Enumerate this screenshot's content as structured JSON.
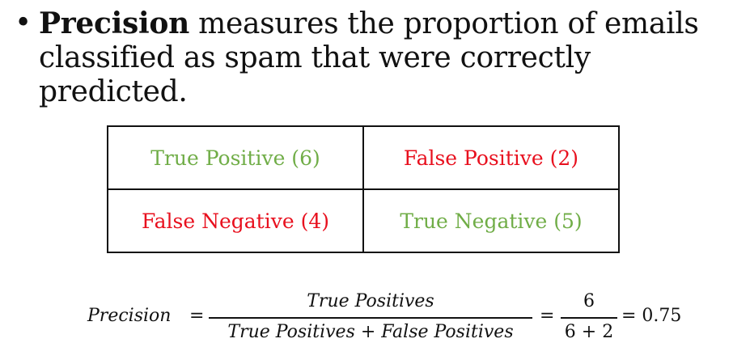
{
  "bullet": {
    "symbol": "•",
    "term": "Precision",
    "line1_rest": " measures the proportion of emails",
    "line2": "classified as spam that were correctly predicted."
  },
  "matrix": {
    "cells": [
      [
        "True Positive (6)",
        "False Positive (2)"
      ],
      [
        "False Negative (4)",
        "True Negative (5)"
      ]
    ],
    "colors": {
      "correct": "#70ad47",
      "incorrect": "#e8101e"
    }
  },
  "formula": {
    "lhs": "Precision",
    "equals": "=",
    "fraction1_numerator": "True Positives",
    "fraction1_denominator": "True Positives + False Positives",
    "fraction2_numerator": "6",
    "fraction2_denominator": "6 + 2",
    "result": "= 0.75"
  }
}
